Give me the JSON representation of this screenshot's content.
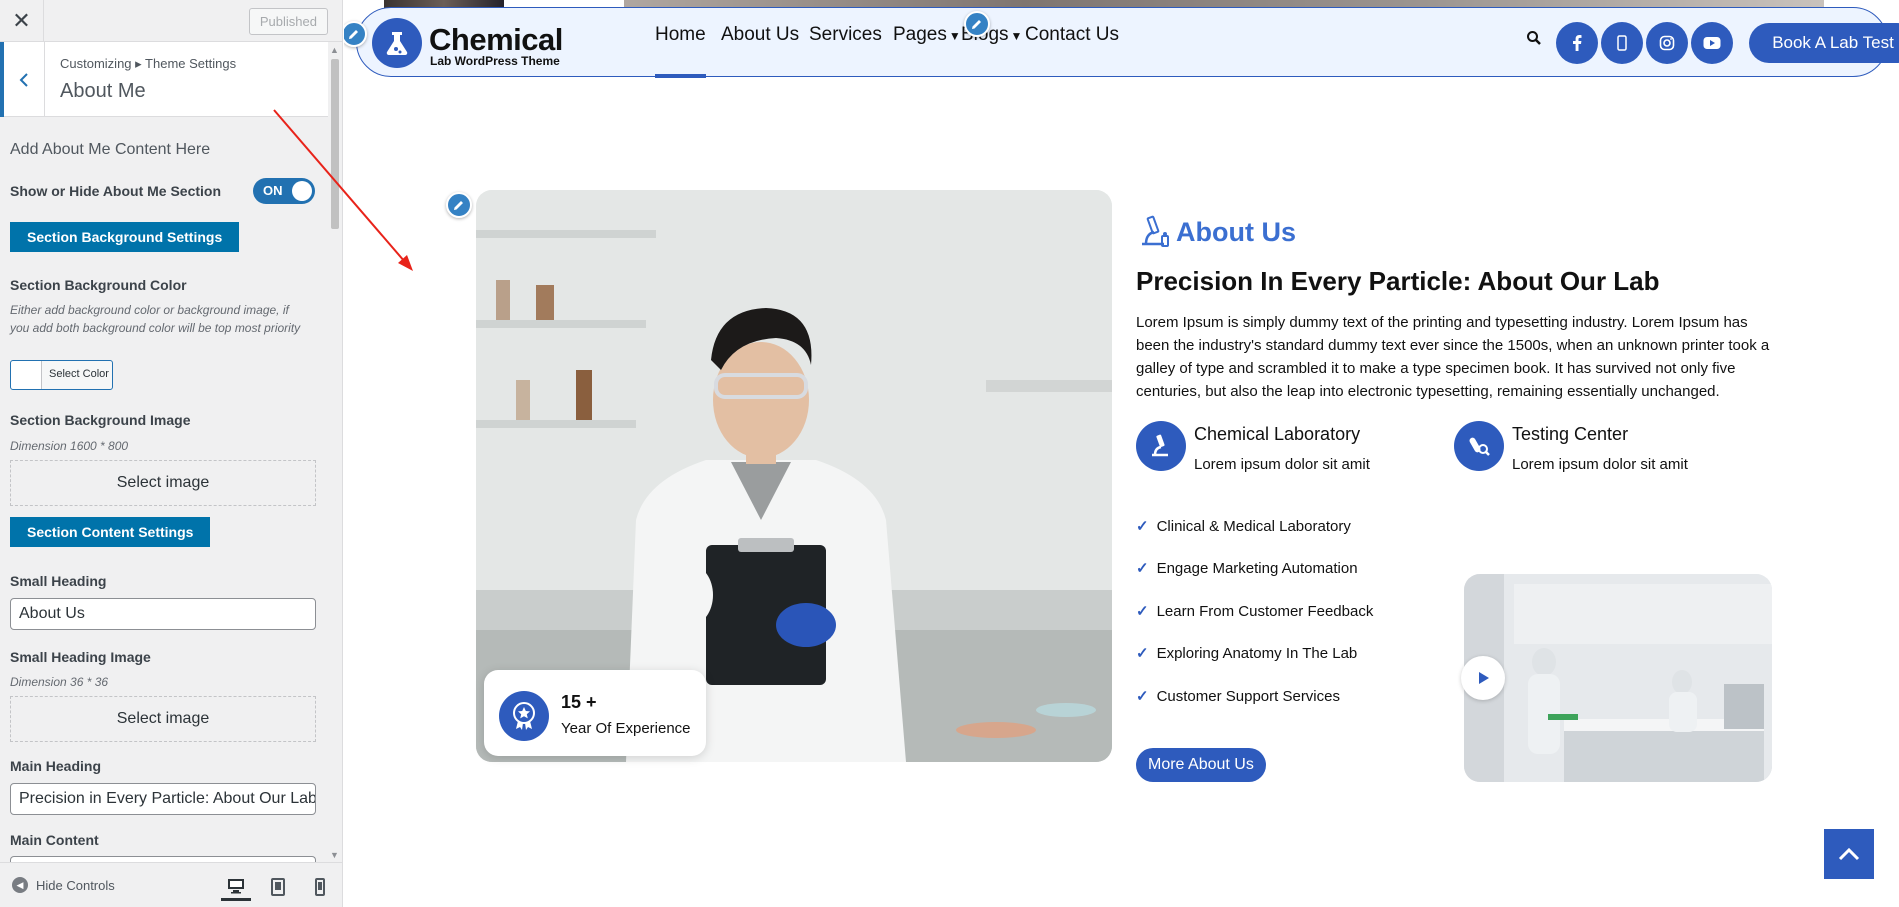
{
  "customizer": {
    "close_glyph": "✕",
    "published_label": "Published",
    "breadcrumb": "Customizing ▸ Theme Settings",
    "panel_title": "About Me",
    "section_intro": "Add About Me Content Here",
    "show_hide_label": "Show or Hide About Me Section",
    "toggle_label": "ON",
    "bg_settings_button": "Section Background Settings",
    "bg_color_label": "Section Background Color",
    "bg_color_desc": "Either add background color or background image, if you add both background color will be top most priority",
    "select_color_label": "Select Color",
    "bg_image_label": "Section Background Image",
    "bg_image_dimension": "Dimension 1600 * 800",
    "select_image_label": "Select image",
    "content_settings_button": "Section Content Settings",
    "small_heading_label": "Small Heading",
    "small_heading_value": "About Us",
    "small_heading_image_label": "Small Heading Image",
    "small_heading_image_dimension": "Dimension 36 * 36",
    "select_image_label_2": "Select image",
    "main_heading_label": "Main Heading",
    "main_heading_value": "Precision in Every Particle: About Our Lab",
    "main_content_label": "Main Content",
    "hide_controls_label": "Hide Controls"
  },
  "site": {
    "logo_name": "Chemical",
    "logo_tagline": "Lab WordPress Theme",
    "nav": [
      {
        "label": "Home"
      },
      {
        "label": "About Us"
      },
      {
        "label": "Services"
      },
      {
        "label": "Pages"
      },
      {
        "label": "Blogs"
      },
      {
        "label": "Contact Us"
      }
    ],
    "social_icons": [
      "facebook-icon",
      "mobile-icon",
      "instagram-icon",
      "youtube-icon"
    ],
    "book_button": "Book A Lab Test",
    "about": {
      "small_heading": "About Us",
      "main_heading": "Precision In Every Particle: About Our Lab",
      "paragraph": "Lorem Ipsum is simply dummy text of the printing and typesetting industry. Lorem Ipsum has been the industry's standard dummy text ever since the 1500s, when an unknown printer took a galley of type and scrambled it to make a type specimen book. It has survived not only five centuries, but also the leap into electronic typesetting, remaining essentially unchanged.",
      "features": [
        {
          "title": "Chemical Laboratory",
          "desc": "Lorem ipsum dolor sit amit"
        },
        {
          "title": "Testing Center",
          "desc": "Lorem ipsum dolor sit amit"
        }
      ],
      "checklist": [
        "Clinical & Medical Laboratory",
        "Engage Marketing Automation",
        "Learn From Customer Feedback",
        "Exploring Anatomy In The Lab",
        "Customer Support Services"
      ],
      "more_button": "More About Us",
      "experience_number": "15 +",
      "experience_label": "Year Of Experience"
    },
    "colors": {
      "brand": "#2e5bbd",
      "wp_blue": "#2271b1",
      "section_button": "#0073aa"
    }
  }
}
